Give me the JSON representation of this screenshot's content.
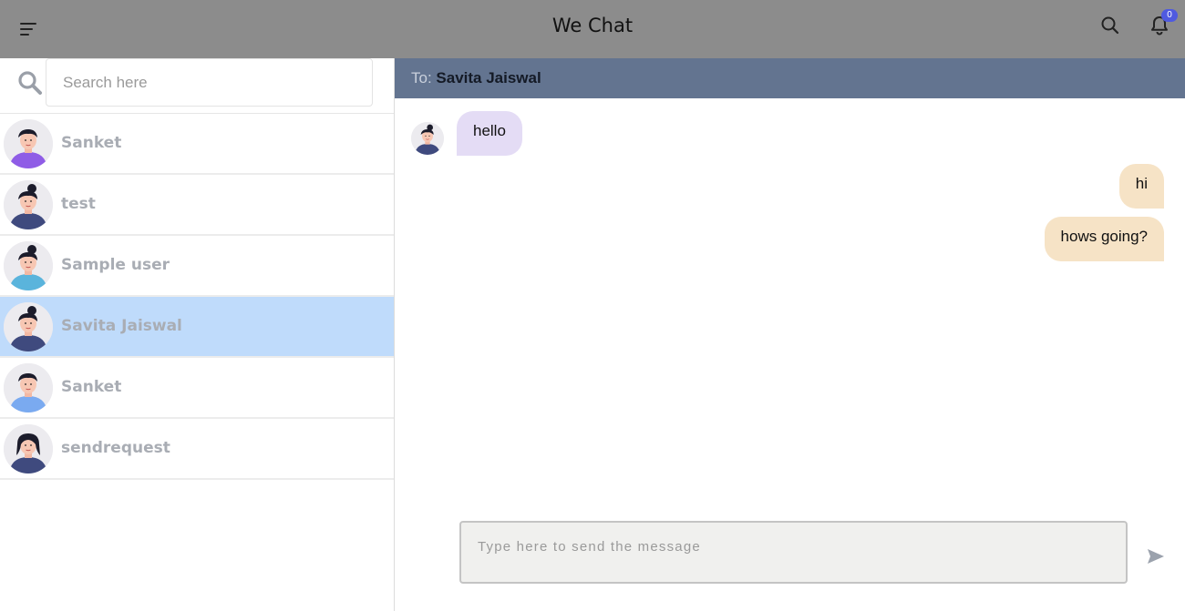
{
  "app": {
    "title": "We Chat",
    "notification_count": "0"
  },
  "search": {
    "placeholder": "Search here"
  },
  "contacts": [
    {
      "name": "Sanket",
      "shirt_color": "#8f5ce6",
      "hair": "short"
    },
    {
      "name": "test",
      "shirt_color": "#3f4a7e",
      "hair": "bun"
    },
    {
      "name": "Sample user",
      "shirt_color": "#5ab4dc",
      "hair": "bun"
    },
    {
      "name": "Savita Jaiswal",
      "shirt_color": "#3f4a7e",
      "hair": "bun",
      "active": true
    },
    {
      "name": "Sanket",
      "shirt_color": "#7aaaf0",
      "hair": "short"
    },
    {
      "name": "sendrequest",
      "shirt_color": "#3f4a7e",
      "hair": "long"
    }
  ],
  "chat": {
    "to_label": "To: ",
    "recipient": "Savita Jaiswal",
    "messages": [
      {
        "text": "hello",
        "direction": "incoming"
      },
      {
        "text": "hi",
        "direction": "outgoing"
      },
      {
        "text": "hows going?",
        "direction": "outgoing"
      }
    ],
    "input_placeholder": "Type here to send the message"
  },
  "icons": {
    "menu": "menu-icon",
    "search": "search-icon",
    "notifications": "bell-icon",
    "send": "send-icon"
  },
  "colors": {
    "topbar": "#8c8c8c",
    "chat_header": "#637490",
    "active_contact": "#bfdbfb",
    "incoming_bubble": "#e4dcf5",
    "outgoing_bubble": "#f6e3c6",
    "badge": "#4f5ae0"
  }
}
